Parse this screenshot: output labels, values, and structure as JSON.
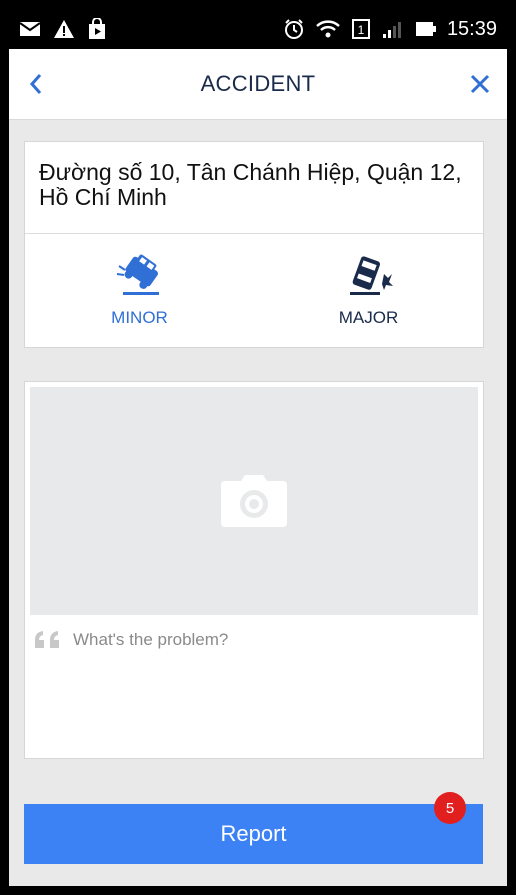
{
  "status_bar": {
    "time": "15:39",
    "icons": [
      "mail-icon",
      "warning-icon",
      "shopping-bag-icon",
      "alarm-icon",
      "wifi-icon",
      "sim-icon",
      "signal-icon",
      "battery-icon"
    ]
  },
  "header": {
    "title": "ACCIDENT",
    "back_icon": "chevron-left-icon",
    "close_icon": "close-icon"
  },
  "location": {
    "address": "Đường số 10,  Tân Chánh Hiệp,  Quận 12,  Hồ Chí Minh"
  },
  "severity": {
    "minor_label": "MINOR",
    "major_label": "MAJOR"
  },
  "photo": {
    "icon": "camera-icon"
  },
  "problem": {
    "placeholder": "What's the problem?",
    "icon": "quote-icon"
  },
  "report": {
    "label": "Report",
    "badge": "5"
  },
  "colors": {
    "accent": "#3d82f4",
    "minor": "#2f6fd6",
    "badge": "#e21f1f",
    "title": "#1a2a4a"
  }
}
